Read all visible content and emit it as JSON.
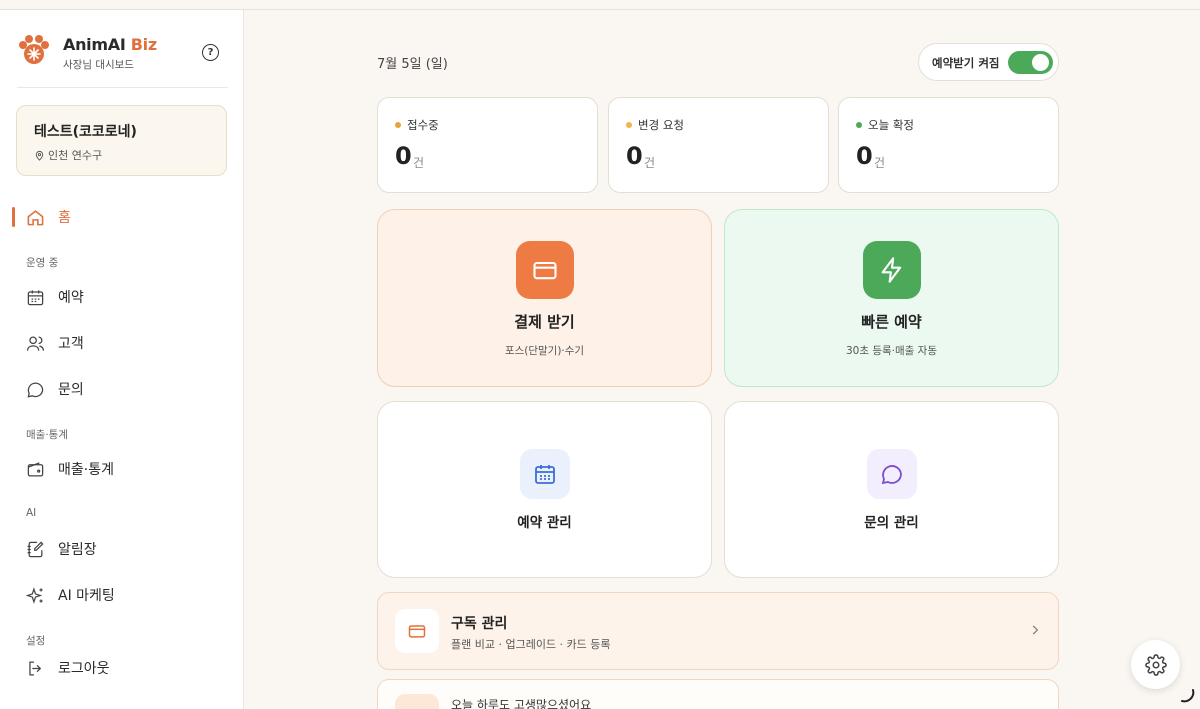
{
  "brand": {
    "name_main": "AnimAI",
    "name_accent": "Biz",
    "subtitle": "사장님 대시보드",
    "help": "?"
  },
  "store": {
    "name": "테스트(코코로네)",
    "location": "인천 연수구"
  },
  "nav": {
    "home": "홈",
    "section_ops": "운영 중",
    "reservations": "예약",
    "customers": "고객",
    "inquiries": "문의",
    "section_sales": "매출·통계",
    "sales": "매출·통계",
    "section_ai": "AI",
    "notices": "알림장",
    "ai_marketing": "AI 마케팅",
    "section_settings": "설정",
    "logout": "로그아웃"
  },
  "header": {
    "date": "7월 5일 (일)",
    "toggle_label": "예약받기 켜짐",
    "toggle_on": true
  },
  "stats": [
    {
      "label": "접수중",
      "value": "0",
      "unit": "건",
      "color": "#e8a33d"
    },
    {
      "label": "변경 요청",
      "value": "0",
      "unit": "건",
      "color": "#f0b646"
    },
    {
      "label": "오늘 확정",
      "value": "0",
      "unit": "건",
      "color": "#4ca95a"
    }
  ],
  "tiles": {
    "payment": {
      "title": "결제 받기",
      "sub": "포스(단말기)·수기"
    },
    "quick": {
      "title": "빠른 예약",
      "sub": "30초 등록·매출 자동"
    },
    "reservation_mgmt": {
      "title": "예약 관리"
    },
    "inquiry_mgmt": {
      "title": "문의 관리"
    }
  },
  "subscription": {
    "title": "구독 관리",
    "desc": "플랜 비교 · 업그레이드 · 카드 등록"
  },
  "greeting": {
    "text": "오늘 하루도 고생많으셨어요"
  },
  "colors": {
    "accent": "#e0703d",
    "green": "#4ca95a",
    "blue": "#3d6fd1",
    "purple": "#7b4bd0"
  }
}
